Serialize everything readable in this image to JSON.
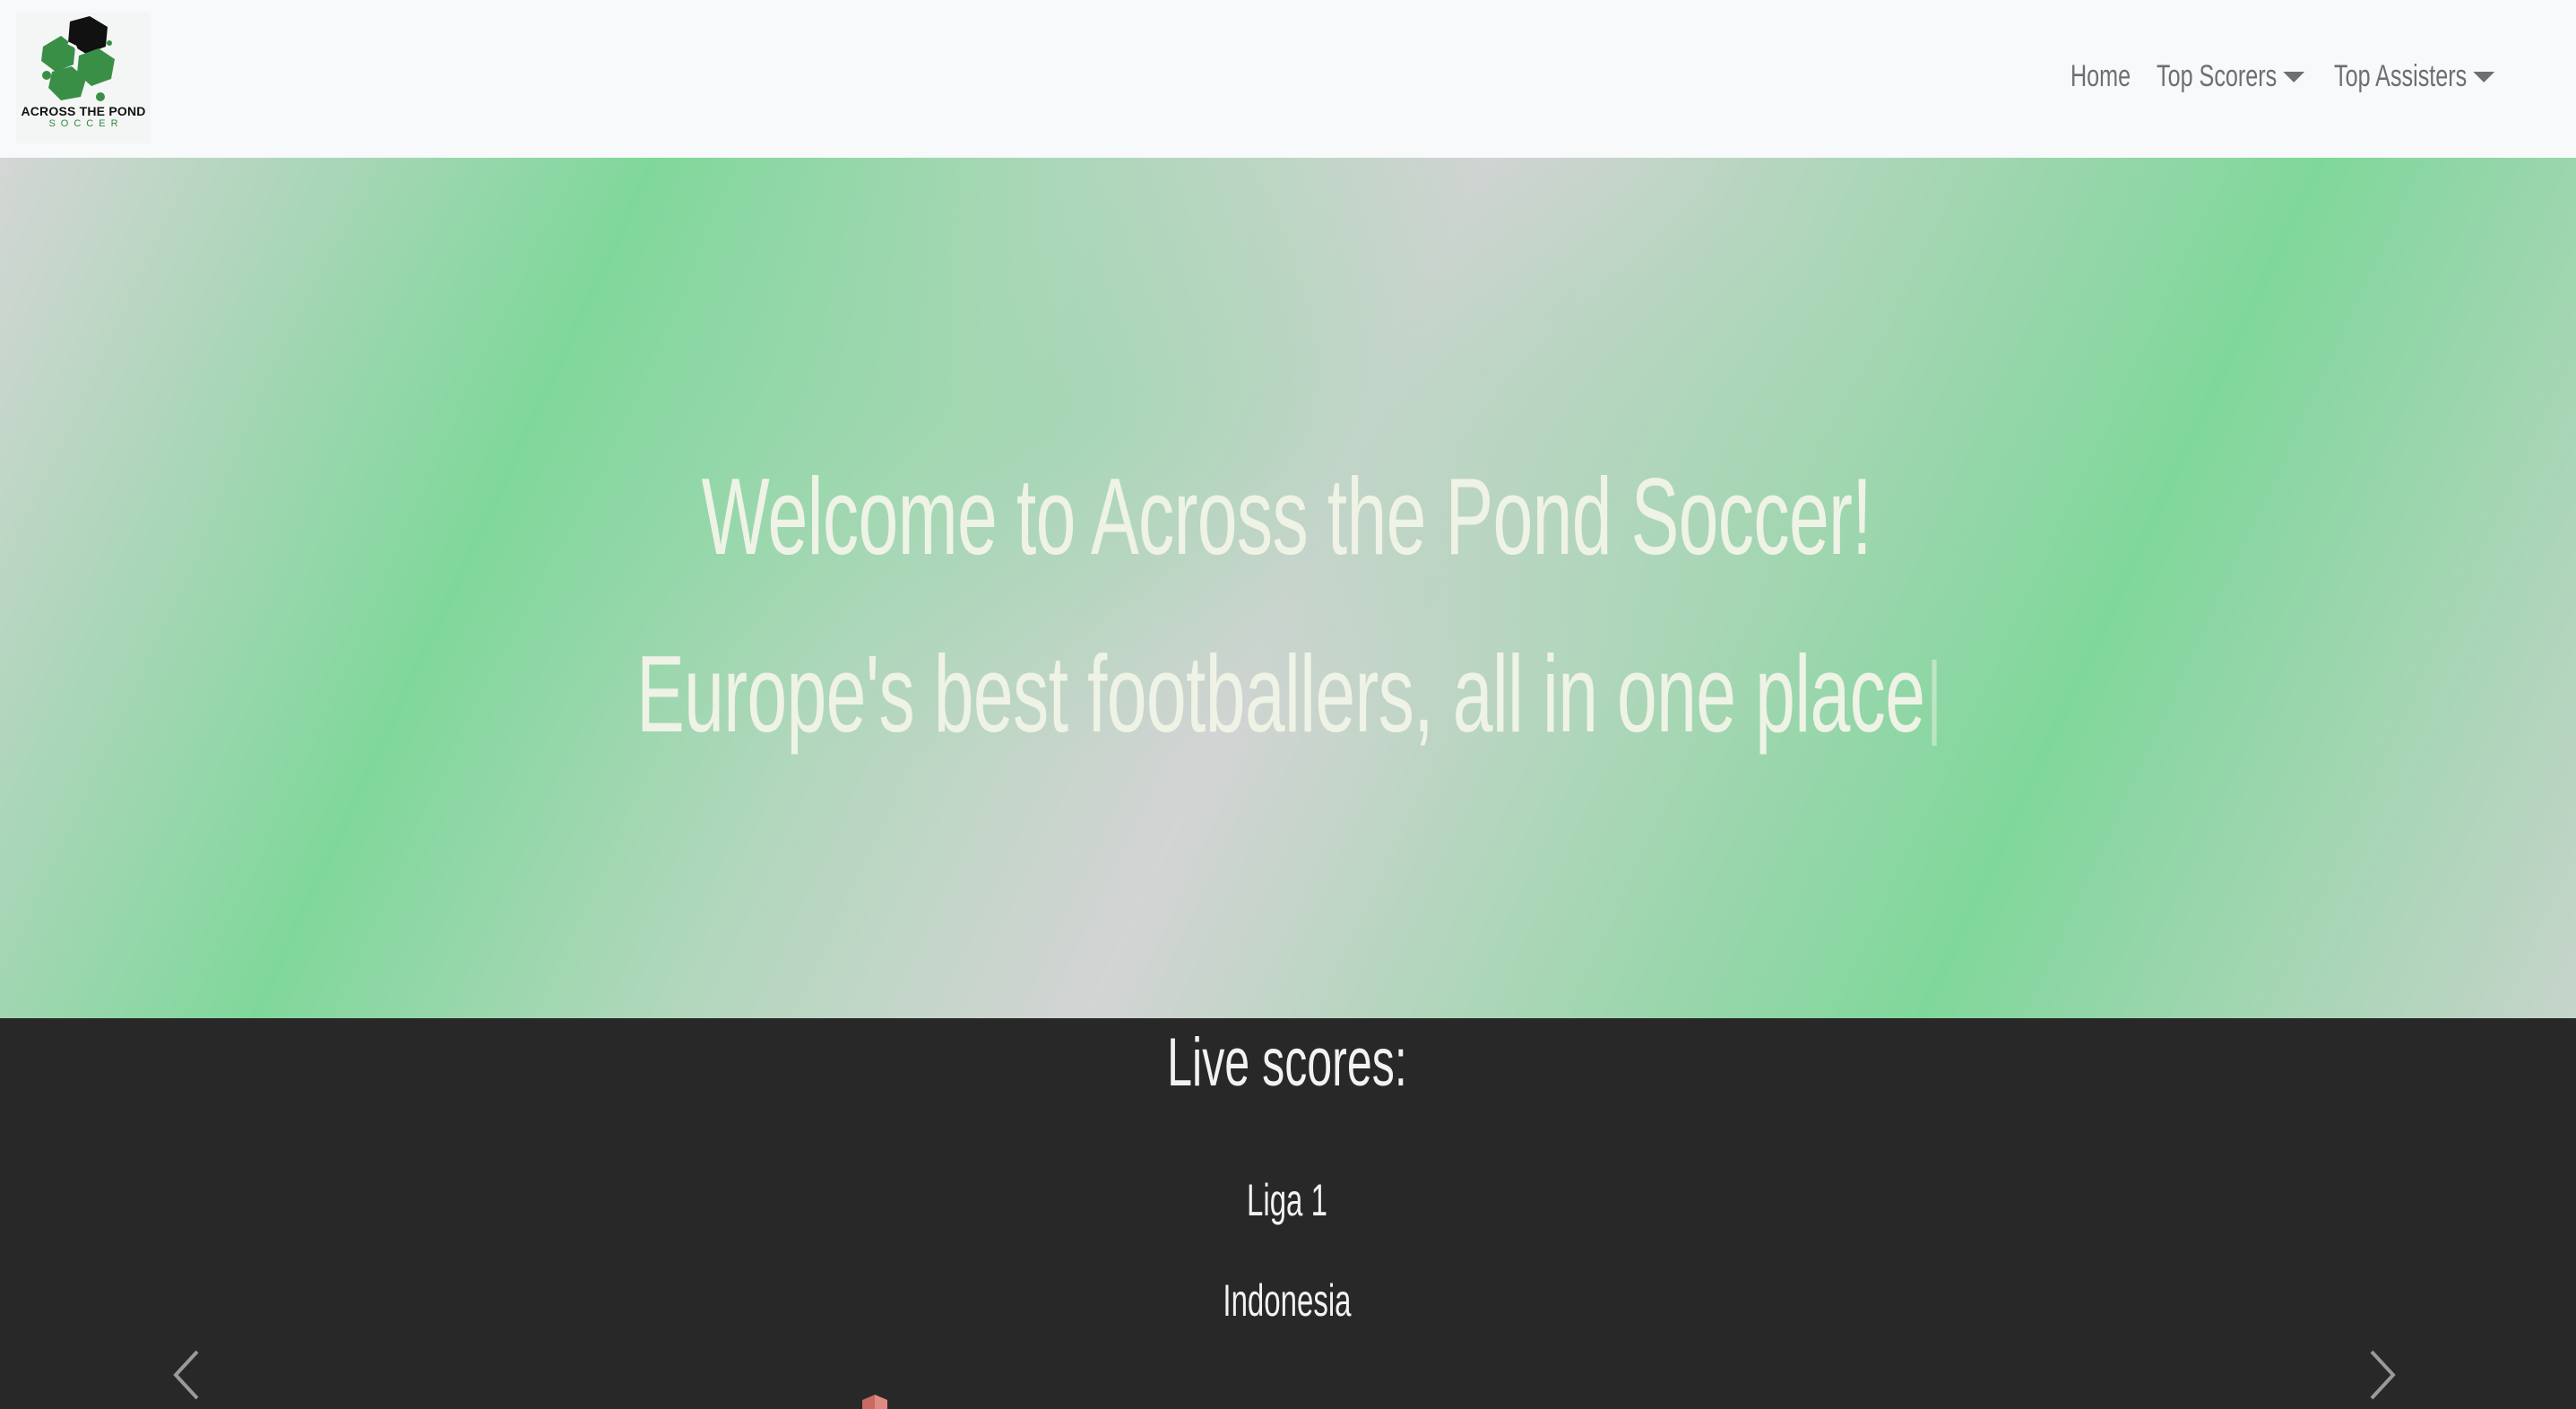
{
  "brand": {
    "line1": "ACROSS THE POND",
    "line2": "SOCCER"
  },
  "nav": {
    "home": "Home",
    "top_scorers": "Top Scorers",
    "top_assisters": "Top Assisters"
  },
  "hero": {
    "title": "Welcome to Across the Pond Soccer!",
    "subtitle": "Europe's best footballers, all in one place"
  },
  "live_scores": {
    "heading": "Live scores:",
    "league": "Liga 1",
    "country": "Indonesia"
  },
  "icons": {
    "logo": "soccer-ball-logo",
    "prev": "chevron-left-icon",
    "next": "chevron-right-icon",
    "crest": "team-crest-icon",
    "dropdown": "caret-down-icon"
  },
  "colors": {
    "navbar_bg": "#f8f9fa",
    "nav_text": "#6c6f73",
    "hero_green": "#80d79b",
    "hero_gray": "#d3d4d4",
    "hero_text": "#eef3e6",
    "dark_bg": "#282828",
    "logo_green": "#3a8f47"
  }
}
